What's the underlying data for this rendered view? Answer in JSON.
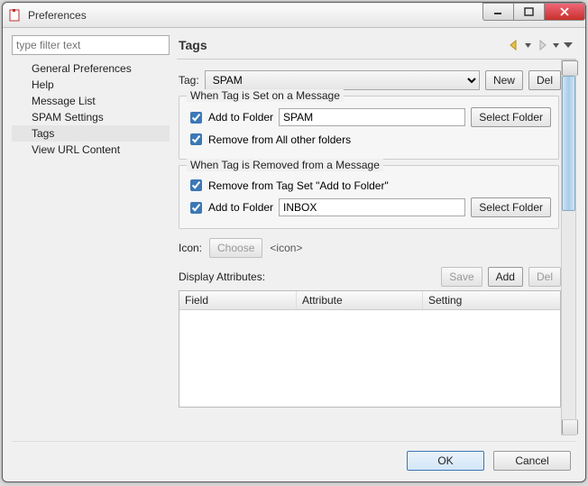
{
  "window": {
    "title": "Preferences"
  },
  "filter": {
    "placeholder": "type filter text"
  },
  "tree": {
    "items": [
      {
        "label": "General Preferences"
      },
      {
        "label": "Help"
      },
      {
        "label": "Message List"
      },
      {
        "label": "SPAM Settings"
      },
      {
        "label": "Tags"
      },
      {
        "label": "View URL Content"
      }
    ],
    "selected_index": 4
  },
  "page": {
    "heading": "Tags",
    "tag_label": "Tag:",
    "tag_combo": {
      "selected": "SPAM",
      "options": [
        "SPAM"
      ]
    },
    "new_btn": "New",
    "del_btn": "Del",
    "group_set": {
      "legend": "When Tag is Set on a Message",
      "add_folder_label": "Add to Folder",
      "add_folder_value": "SPAM",
      "select_folder_btn": "Select Folder",
      "remove_all_label": "Remove from All other folders"
    },
    "group_removed": {
      "legend": "When Tag is Removed from a Message",
      "remove_tagset_label": "Remove from Tag Set \"Add to Folder\"",
      "add_folder_label": "Add to Folder",
      "add_folder_value": "INBOX",
      "select_folder_btn": "Select Folder"
    },
    "icon_row": {
      "label": "Icon:",
      "choose_btn": "Choose",
      "hint": "<icon>"
    },
    "attrs": {
      "label": "Display Attributes:",
      "save_btn": "Save",
      "add_btn": "Add",
      "del_btn": "Del",
      "columns": [
        "Field",
        "Attribute",
        "Setting"
      ]
    }
  },
  "footer": {
    "ok": "OK",
    "cancel": "Cancel"
  }
}
